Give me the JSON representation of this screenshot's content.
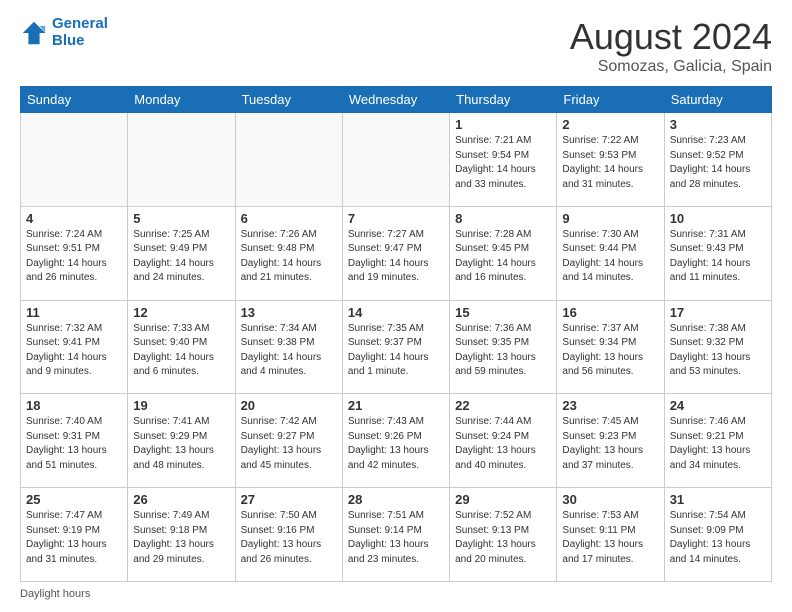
{
  "logo": {
    "line1": "General",
    "line2": "Blue"
  },
  "title": "August 2024",
  "location": "Somozas, Galicia, Spain",
  "days_of_week": [
    "Sunday",
    "Monday",
    "Tuesday",
    "Wednesday",
    "Thursday",
    "Friday",
    "Saturday"
  ],
  "footer_text": "Daylight hours",
  "weeks": [
    [
      {
        "num": "",
        "info": ""
      },
      {
        "num": "",
        "info": ""
      },
      {
        "num": "",
        "info": ""
      },
      {
        "num": "",
        "info": ""
      },
      {
        "num": "1",
        "info": "Sunrise: 7:21 AM\nSunset: 9:54 PM\nDaylight: 14 hours\nand 33 minutes."
      },
      {
        "num": "2",
        "info": "Sunrise: 7:22 AM\nSunset: 9:53 PM\nDaylight: 14 hours\nand 31 minutes."
      },
      {
        "num": "3",
        "info": "Sunrise: 7:23 AM\nSunset: 9:52 PM\nDaylight: 14 hours\nand 28 minutes."
      }
    ],
    [
      {
        "num": "4",
        "info": "Sunrise: 7:24 AM\nSunset: 9:51 PM\nDaylight: 14 hours\nand 26 minutes."
      },
      {
        "num": "5",
        "info": "Sunrise: 7:25 AM\nSunset: 9:49 PM\nDaylight: 14 hours\nand 24 minutes."
      },
      {
        "num": "6",
        "info": "Sunrise: 7:26 AM\nSunset: 9:48 PM\nDaylight: 14 hours\nand 21 minutes."
      },
      {
        "num": "7",
        "info": "Sunrise: 7:27 AM\nSunset: 9:47 PM\nDaylight: 14 hours\nand 19 minutes."
      },
      {
        "num": "8",
        "info": "Sunrise: 7:28 AM\nSunset: 9:45 PM\nDaylight: 14 hours\nand 16 minutes."
      },
      {
        "num": "9",
        "info": "Sunrise: 7:30 AM\nSunset: 9:44 PM\nDaylight: 14 hours\nand 14 minutes."
      },
      {
        "num": "10",
        "info": "Sunrise: 7:31 AM\nSunset: 9:43 PM\nDaylight: 14 hours\nand 11 minutes."
      }
    ],
    [
      {
        "num": "11",
        "info": "Sunrise: 7:32 AM\nSunset: 9:41 PM\nDaylight: 14 hours\nand 9 minutes."
      },
      {
        "num": "12",
        "info": "Sunrise: 7:33 AM\nSunset: 9:40 PM\nDaylight: 14 hours\nand 6 minutes."
      },
      {
        "num": "13",
        "info": "Sunrise: 7:34 AM\nSunset: 9:38 PM\nDaylight: 14 hours\nand 4 minutes."
      },
      {
        "num": "14",
        "info": "Sunrise: 7:35 AM\nSunset: 9:37 PM\nDaylight: 14 hours\nand 1 minute."
      },
      {
        "num": "15",
        "info": "Sunrise: 7:36 AM\nSunset: 9:35 PM\nDaylight: 13 hours\nand 59 minutes."
      },
      {
        "num": "16",
        "info": "Sunrise: 7:37 AM\nSunset: 9:34 PM\nDaylight: 13 hours\nand 56 minutes."
      },
      {
        "num": "17",
        "info": "Sunrise: 7:38 AM\nSunset: 9:32 PM\nDaylight: 13 hours\nand 53 minutes."
      }
    ],
    [
      {
        "num": "18",
        "info": "Sunrise: 7:40 AM\nSunset: 9:31 PM\nDaylight: 13 hours\nand 51 minutes."
      },
      {
        "num": "19",
        "info": "Sunrise: 7:41 AM\nSunset: 9:29 PM\nDaylight: 13 hours\nand 48 minutes."
      },
      {
        "num": "20",
        "info": "Sunrise: 7:42 AM\nSunset: 9:27 PM\nDaylight: 13 hours\nand 45 minutes."
      },
      {
        "num": "21",
        "info": "Sunrise: 7:43 AM\nSunset: 9:26 PM\nDaylight: 13 hours\nand 42 minutes."
      },
      {
        "num": "22",
        "info": "Sunrise: 7:44 AM\nSunset: 9:24 PM\nDaylight: 13 hours\nand 40 minutes."
      },
      {
        "num": "23",
        "info": "Sunrise: 7:45 AM\nSunset: 9:23 PM\nDaylight: 13 hours\nand 37 minutes."
      },
      {
        "num": "24",
        "info": "Sunrise: 7:46 AM\nSunset: 9:21 PM\nDaylight: 13 hours\nand 34 minutes."
      }
    ],
    [
      {
        "num": "25",
        "info": "Sunrise: 7:47 AM\nSunset: 9:19 PM\nDaylight: 13 hours\nand 31 minutes."
      },
      {
        "num": "26",
        "info": "Sunrise: 7:49 AM\nSunset: 9:18 PM\nDaylight: 13 hours\nand 29 minutes."
      },
      {
        "num": "27",
        "info": "Sunrise: 7:50 AM\nSunset: 9:16 PM\nDaylight: 13 hours\nand 26 minutes."
      },
      {
        "num": "28",
        "info": "Sunrise: 7:51 AM\nSunset: 9:14 PM\nDaylight: 13 hours\nand 23 minutes."
      },
      {
        "num": "29",
        "info": "Sunrise: 7:52 AM\nSunset: 9:13 PM\nDaylight: 13 hours\nand 20 minutes."
      },
      {
        "num": "30",
        "info": "Sunrise: 7:53 AM\nSunset: 9:11 PM\nDaylight: 13 hours\nand 17 minutes."
      },
      {
        "num": "31",
        "info": "Sunrise: 7:54 AM\nSunset: 9:09 PM\nDaylight: 13 hours\nand 14 minutes."
      }
    ]
  ]
}
